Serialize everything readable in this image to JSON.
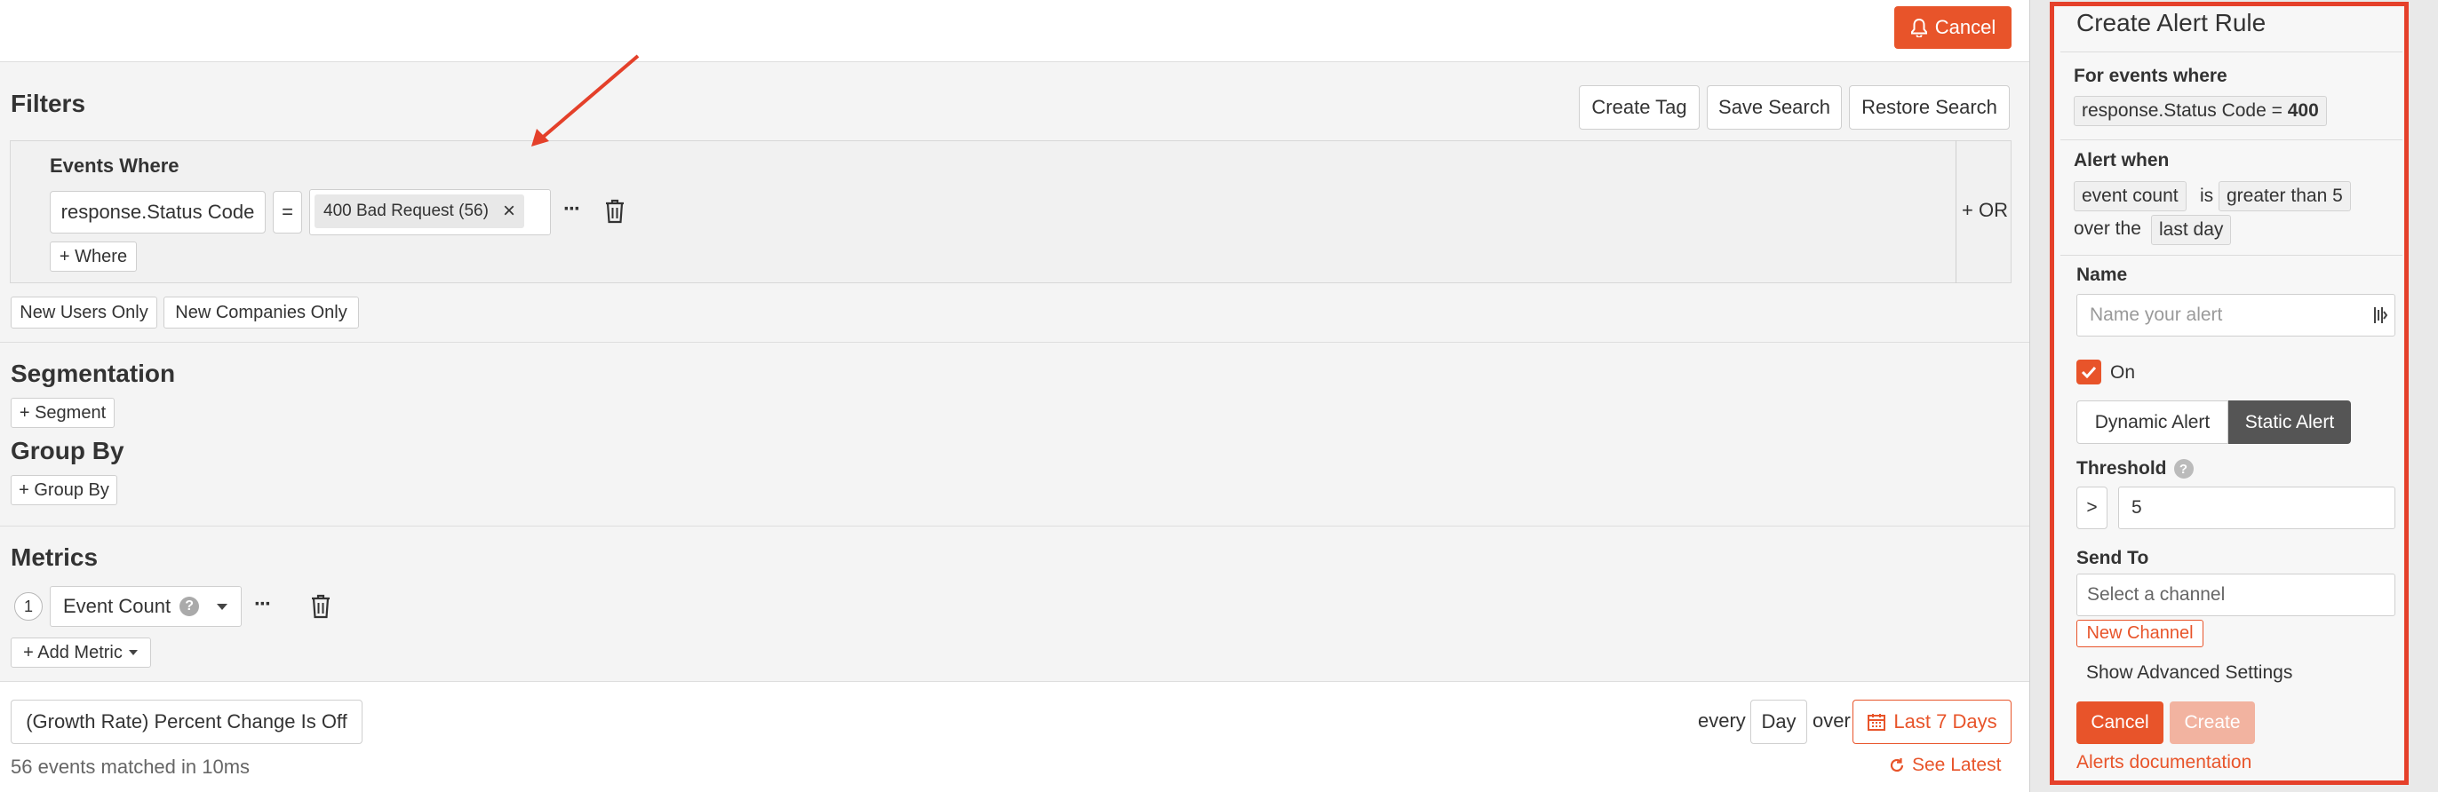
{
  "topbar": {
    "cancel_label": "Cancel"
  },
  "filters": {
    "title": "Filters",
    "create_tag": "Create Tag",
    "save_search": "Save Search",
    "restore_search": "Restore Search",
    "events_where": "Events Where",
    "field": "response.Status Code",
    "operator": "=",
    "value_tag": "400 Bad Request (56)",
    "remove_symbol": "×",
    "more_symbol": "···",
    "add_where": "+ Where",
    "add_or": "+ OR",
    "new_users_only": "New Users Only",
    "new_companies_only": "New Companies Only"
  },
  "segmentation": {
    "title": "Segmentation",
    "add_segment": "+ Segment"
  },
  "group_by": {
    "title": "Group By",
    "add_group_by": "+ Group By"
  },
  "metrics": {
    "title": "Metrics",
    "index": "1",
    "metric_name": "Event Count",
    "help_symbol": "?",
    "more_symbol": "···",
    "add_metric": "+ Add Metric"
  },
  "bottom": {
    "growth_rate": "(Growth Rate) Percent Change Is Off",
    "every_label": "every",
    "interval": "Day",
    "over_label": "over",
    "range": "Last 7 Days",
    "matched": "56 events matched in 10ms",
    "see_latest": "See Latest"
  },
  "panel": {
    "title": "Create Alert Rule",
    "for_events_where": "For events where",
    "condition_prefix": "response.Status Code = ",
    "condition_value": "400",
    "alert_when": "Alert when",
    "metric_chip": "event count",
    "is_label": "is",
    "comparison_chip": "greater than 5",
    "over_the_label": "over the",
    "period_chip": "last day",
    "name_label": "Name",
    "name_placeholder": "Name your alert",
    "on_label": "On",
    "dynamic_alert": "Dynamic Alert",
    "static_alert": "Static Alert",
    "threshold_label": "Threshold",
    "threshold_operator": ">",
    "threshold_value": "5",
    "send_to_label": "Send To",
    "channel_placeholder": "Select a channel",
    "new_channel": "New Channel",
    "advanced_settings": "Show Advanced Settings",
    "cancel": "Cancel",
    "create": "Create",
    "docs_link": "Alerts documentation"
  },
  "colors": {
    "accent": "#e8542a",
    "highlight_border": "#e5402a",
    "dark_toggle": "#555555"
  }
}
